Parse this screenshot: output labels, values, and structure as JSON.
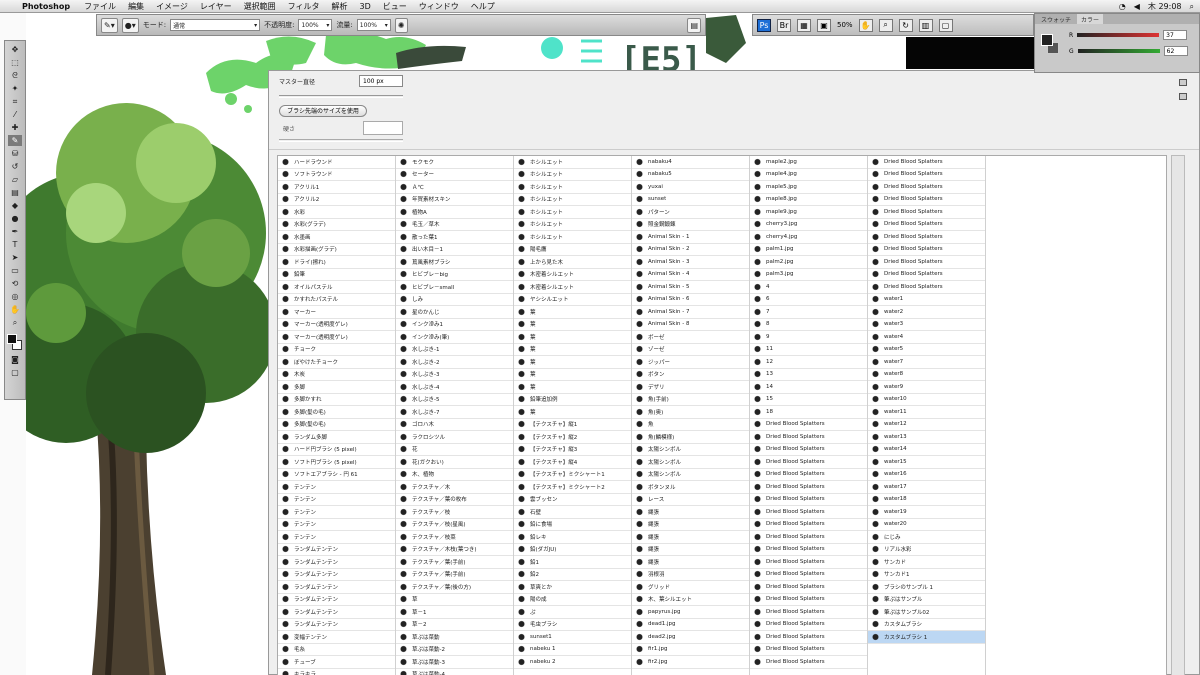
{
  "menubar": {
    "app": "Photoshop",
    "items": [
      "ファイル",
      "編集",
      "イメージ",
      "レイヤー",
      "選択範囲",
      "フィルタ",
      "解析",
      "3D",
      "ビュー",
      "ウィンドウ",
      "ヘルプ"
    ],
    "clock": "木 29:08"
  },
  "options": {
    "mode_label": "モード:",
    "mode_value": "通常",
    "opacity_label": "不透明度:",
    "opacity_value": "100%",
    "flow_label": "流量:",
    "flow_value": "100%"
  },
  "appbar": {
    "zoom": "50%"
  },
  "colorpanel": {
    "tabs": [
      "スウォッチ",
      "カラー"
    ],
    "r_label": "R",
    "r_value": "37",
    "g_label": "G",
    "g_value": "62"
  },
  "brushpanel": {
    "master_label": "マスター直径",
    "master_value": "100 px",
    "sample_button": "ブラシ先端のサイズを使用",
    "hardness_label": "硬さ"
  },
  "brushes": [
    [
      "ハードラウンド",
      "ソフトラウンド",
      "アクリル1",
      "アクリル2",
      "水彩",
      "水彩(グラデ)",
      "水墨画",
      "水彩描画(グラデ)",
      "ドライ(擦れ)",
      "鉛筆",
      "オイルパステル",
      "かすれたパステル",
      "マーカー",
      "マーカー(透明度ゲレ)",
      "マーカー(透明度ゲレ)",
      "チョーク",
      "ぼやけたチョーク",
      "木炭",
      "多脚",
      "多脚かすれ",
      "多脚(髪の毛)",
      "多脚(髪の毛)",
      "ランダム多脚",
      "ハード円ブラシ (5 pixel)",
      "ソフト円ブラシ (5 pixel)",
      "ソフトエアブラシ - 円 61",
      "テンテン",
      "テンテン",
      "テンテン",
      "テンテン",
      "テンテン",
      "ランダムテンテン",
      "ランダムテンテン",
      "ランダムテンテン",
      "ランダムテンテン",
      "ランダムテンテン",
      "ランダムテンテン",
      "ランダムテンテン",
      "変幅テンテン",
      "毛糸",
      "チューブ",
      "キラキラ"
    ],
    [
      "モクモク",
      "セーター",
      "Ａ℃",
      "年賀素材スキン",
      "植物A",
      "毛玉／草木",
      "散った葉1",
      "出い木目－1",
      "蔦風素材ブラシ",
      "ヒビブレ－big",
      "ヒビブレ－small",
      "しみ",
      "星のかんじ",
      "インク滲み1",
      "インク滲み(筆)",
      "水しぶき-1",
      "水しぶき-2",
      "水しぶき-3",
      "水しぶき-4",
      "水しぶき-5",
      "水しぶき-7",
      "ゴロハ木",
      "ラクロシツル",
      "花",
      "花(ガクおい)",
      "木、植物",
      "テクスチャ／木",
      "テクスチャ／葉の枚布",
      "テクスチャ／枝",
      "テクスチャ／枝(星風)",
      "テクスチャ／枝菜",
      "テクスチャ／木枝(葉つき)",
      "テクスチャ／葉(手前)",
      "テクスチャ／葉(手前)",
      "テクスチャ／葉(後の方)",
      "草",
      "草－1",
      "草－2",
      "草ぷは菜動",
      "草ぷは菜動-2",
      "草ぷは菜動-3",
      "草ぷは菜動-4"
    ],
    [
      "ホシルエット",
      "ホシルエット",
      "ホシルエット",
      "ホシルエット",
      "ホシルエット",
      "ホシルエット",
      "ホシルエット",
      "陽毛鷹",
      "上から見た木",
      "木密着シルエット",
      "木密着シルエット",
      "ヤシシルエット",
      "葉",
      "葉",
      "葉",
      "葉",
      "葉",
      "葉",
      "葉",
      "鉛筆追加例",
      "葉",
      "【テクスチャ】縦1",
      "【テクスチャ】縦2",
      "【テクスチャ】縦3",
      "【テクスチャ】縦4",
      "【テクスチャ】ミクシャート1",
      "【テクスチャ】ミクシャート2",
      "雲ブッセン",
      "石壁",
      "鉛に食場",
      "鉛レキ",
      "鉛(ダガJU)",
      "鉛1",
      "鉛2",
      "草爽とか",
      "陽の成",
      "ぷ",
      "毛虫ブラシ",
      "sunset1",
      "nabeku 1",
      "nabeku 2"
    ],
    [
      "nabaku4",
      "nabaku5",
      "yuxai",
      "sunset",
      "パターン",
      "照金鋼鍛錬",
      "Animal Skin - 1",
      "Animal Skin - 2",
      "Animal Skin - 3",
      "Animal Skin - 4",
      "Animal Skin - 5",
      "Animal Skin - 6",
      "Animal Skin - 7",
      "Animal Skin - 8",
      "ボーゼ",
      "ゾーゼ",
      "ジッパー",
      "ボタン",
      "デザリ",
      "魚(手前)",
      "魚(奥)",
      "魚",
      "魚(鱗模様)",
      "太陽シンボル",
      "太陽シンボル",
      "太陽シンボル",
      "ボタンヌル",
      "レース",
      "縄張",
      "縄張",
      "縄張",
      "縄張",
      "縄張",
      "羽根羽",
      "グリッド",
      "木、葉シルエット",
      "papyrus.jpg",
      "dead1.jpg",
      "dead2.jpg",
      "fir1.jpg",
      "fir2.jpg"
    ],
    [
      "maple2.jpg",
      "maple4.jpg",
      "maple5.jpg",
      "maple8.jpg",
      "maple9.jpg",
      "cherry3.jpg",
      "cherry4.jpg",
      "palm1.jpg",
      "palm2.jpg",
      "palm3.jpg",
      "4",
      "6",
      "7",
      "8",
      "9",
      "11",
      "12",
      "13",
      "14",
      "15",
      "18",
      "Dried Blood Splatters",
      "Dried Blood Splatters",
      "Dried Blood Splatters",
      "Dried Blood Splatters",
      "Dried Blood Splatters",
      "Dried Blood Splatters",
      "Dried Blood Splatters",
      "Dried Blood Splatters",
      "Dried Blood Splatters",
      "Dried Blood Splatters",
      "Dried Blood Splatters",
      "Dried Blood Splatters",
      "Dried Blood Splatters",
      "Dried Blood Splatters",
      "Dried Blood Splatters",
      "Dried Blood Splatters",
      "Dried Blood Splatters",
      "Dried Blood Splatters",
      "Dried Blood Splatters",
      "Dried Blood Splatters"
    ],
    [
      "Dried Blood Splatters",
      "Dried Blood Splatters",
      "Dried Blood Splatters",
      "Dried Blood Splatters",
      "Dried Blood Splatters",
      "Dried Blood Splatters",
      "Dried Blood Splatters",
      "Dried Blood Splatters",
      "Dried Blood Splatters",
      "Dried Blood Splatters",
      "Dried Blood Splatters",
      "water1",
      "water2",
      "water3",
      "water4",
      "water5",
      "water7",
      "water8",
      "water9",
      "water10",
      "water11",
      "water12",
      "water13",
      "water14",
      "water15",
      "water16",
      "water17",
      "water18",
      "water19",
      "water20",
      "にじみ",
      "リアル水彩",
      "サンカド",
      "サンカド1",
      "ブラシのサンプル 1",
      "筆ぷはサンプル",
      "筆ぷはサンプル02",
      "カスタムブラシ",
      "カスタムブラシ 1"
    ]
  ],
  "selected_brush": "カスタムブラシ 1",
  "canvas_text": "[E5]"
}
